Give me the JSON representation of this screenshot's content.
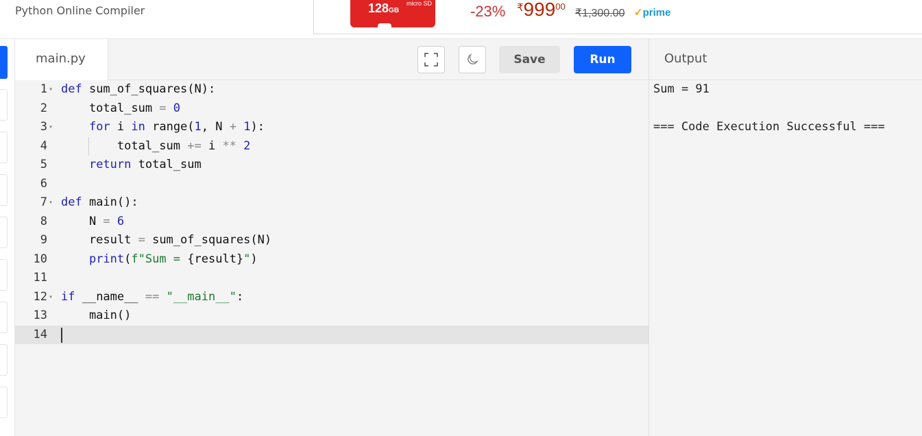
{
  "header": {
    "site_title": "Python Online Compiler"
  },
  "ad": {
    "capacity": "128",
    "capacity_unit": "GB",
    "card_label": "micro SD",
    "discount": "-23%",
    "currency": "₹",
    "price_whole": "999",
    "price_fraction": "00",
    "mrp": "₹1,300.00",
    "prime_check": "✓",
    "prime_label": "prime",
    "colors": {
      "card": "#e02424",
      "price": "#b12704",
      "prime": "#1a98d5"
    }
  },
  "editor": {
    "tab_label": "main.py",
    "fullscreen_icon": "expand-icon",
    "theme_icon": "moon-icon",
    "save_label": "Save",
    "run_label": "Run",
    "active_line": 14,
    "lines": [
      {
        "num": "1",
        "fold": "▾"
      },
      {
        "num": "2",
        "fold": ""
      },
      {
        "num": "3",
        "fold": "▾"
      },
      {
        "num": "4",
        "fold": ""
      },
      {
        "num": "5",
        "fold": ""
      },
      {
        "num": "6",
        "fold": ""
      },
      {
        "num": "7",
        "fold": "▾"
      },
      {
        "num": "8",
        "fold": ""
      },
      {
        "num": "9",
        "fold": ""
      },
      {
        "num": "10",
        "fold": ""
      },
      {
        "num": "11",
        "fold": ""
      },
      {
        "num": "12",
        "fold": "▾"
      },
      {
        "num": "13",
        "fold": ""
      },
      {
        "num": "14",
        "fold": ""
      }
    ],
    "code": {
      "l1": {
        "kw": "def",
        "rest": " sum_of_squares(N):"
      },
      "l2": {
        "a": "    total_sum ",
        "op": "=",
        "sp": " ",
        "num": "0"
      },
      "l3": {
        "ind": "    ",
        "kw1": "for",
        "a": " i ",
        "kw2": "in",
        "b": " range(",
        "n1": "1",
        "c": ", N ",
        "op": "+",
        "d": " ",
        "n2": "1",
        "e": "):"
      },
      "l4": {
        "a": "        total_sum ",
        "op1": "+=",
        "b": " i ",
        "op2": "**",
        "c": " ",
        "num": "2"
      },
      "l5": {
        "ind": "    ",
        "kw": "return",
        "rest": " total_sum"
      },
      "l7": {
        "kw": "def",
        "rest": " main():"
      },
      "l8": {
        "a": "    N ",
        "op": "=",
        "sp": " ",
        "num": "6"
      },
      "l9": {
        "a": "    result ",
        "op": "=",
        "b": " sum_of_squares(N)"
      },
      "l10": {
        "ind": "    ",
        "kw": "print",
        "a": "(",
        "str": "f\"Sum = ",
        "b": "{result}",
        "str2": "\"",
        "c": ")"
      },
      "l12": {
        "kw": "if",
        "a": " __name__ ",
        "op": "==",
        "sp": " ",
        "str": "\"__main__\"",
        "b": ":"
      },
      "l13": {
        "a": "    main()"
      }
    }
  },
  "output": {
    "title": "Output",
    "lines": [
      "Sum = 91",
      "",
      "=== Code Execution Successful ==="
    ]
  }
}
